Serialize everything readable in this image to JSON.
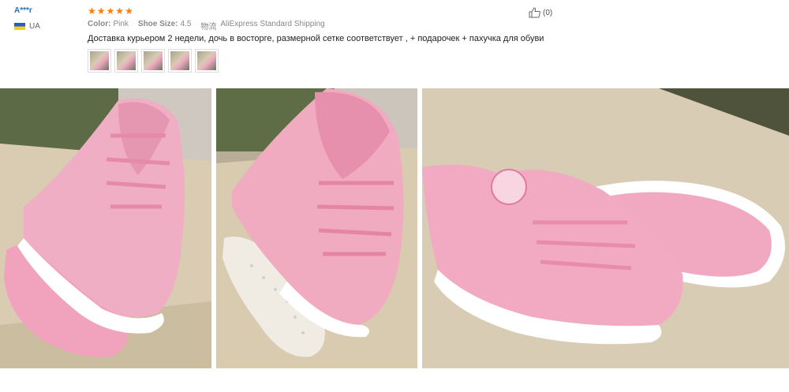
{
  "review": {
    "user_name": "A***r",
    "country": "UA",
    "rating_stars": 5,
    "color_label": "Color:",
    "color_value": "Pink",
    "size_label": "Shoe Size:",
    "size_value": "4.5",
    "logistics_label": "物流",
    "logistics_value": "AliExpress Standard Shipping",
    "text": "Доставка курьером 2 недели, дочь в восторге, размерной сетке соответствует , + подарочек + пахучка для обуви",
    "helpful_count": "(0)",
    "thumbnail_count": 5
  },
  "photos": [
    {
      "name": "photo-1"
    },
    {
      "name": "photo-2"
    },
    {
      "name": "photo-3"
    }
  ],
  "colors": {
    "accent_star": "#ff7d00",
    "user_link": "#2a6bc2",
    "shoe_pink": "#f1a7bf"
  }
}
